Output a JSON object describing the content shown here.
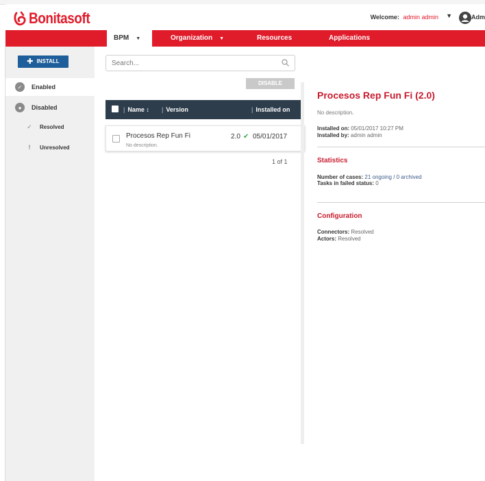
{
  "header": {
    "logo_text": "Bonitasoft",
    "welcome_label": "Welcome:",
    "user_name": "admin admin",
    "profile_label": "Adm"
  },
  "nav": {
    "tabs": [
      {
        "label": "BPM"
      },
      {
        "label": "Organization"
      },
      {
        "label": "Resources"
      },
      {
        "label": "Applications"
      }
    ]
  },
  "sidebar": {
    "install_label": "INSTALL",
    "items": [
      {
        "label": "Enabled"
      },
      {
        "label": "Disabled"
      },
      {
        "label": "Resolved"
      },
      {
        "label": "Unresolved"
      }
    ]
  },
  "search": {
    "placeholder": "Search..."
  },
  "toolbar": {
    "disable_label": "DISABLE"
  },
  "table": {
    "columns": [
      "Name",
      "Version",
      "Installed on"
    ],
    "sort_glyph": "↕",
    "rows": [
      {
        "name": "Procesos Rep Fun Fi",
        "description": "No description.",
        "version": "2.0",
        "installed_on": "05/01/2017"
      }
    ],
    "pagination": "1 of 1"
  },
  "detail": {
    "title": "Procesos Rep Fun Fi (2.0)",
    "description": "No description.",
    "installed_on_label": "Installed on:",
    "installed_on_value": "05/01/2017 10:27 PM",
    "installed_by_label": "Installed by:",
    "installed_by_value": "admin admin",
    "statistics_title": "Statistics",
    "cases_label": "Number of cases:",
    "cases_value": "21 ongoing / 0 archived",
    "failed_label": "Tasks in failed status:",
    "failed_value": "0",
    "configuration_title": "Configuration",
    "connectors_label": "Connectors:",
    "connectors_value": "Resolved",
    "actors_label": "Actors:",
    "actors_value": "Resolved"
  },
  "colors": {
    "brand_red": "#e01b2a",
    "install_blue": "#1e5e9a",
    "table_header": "#2e3d4c",
    "success_green": "#3aa84a"
  }
}
